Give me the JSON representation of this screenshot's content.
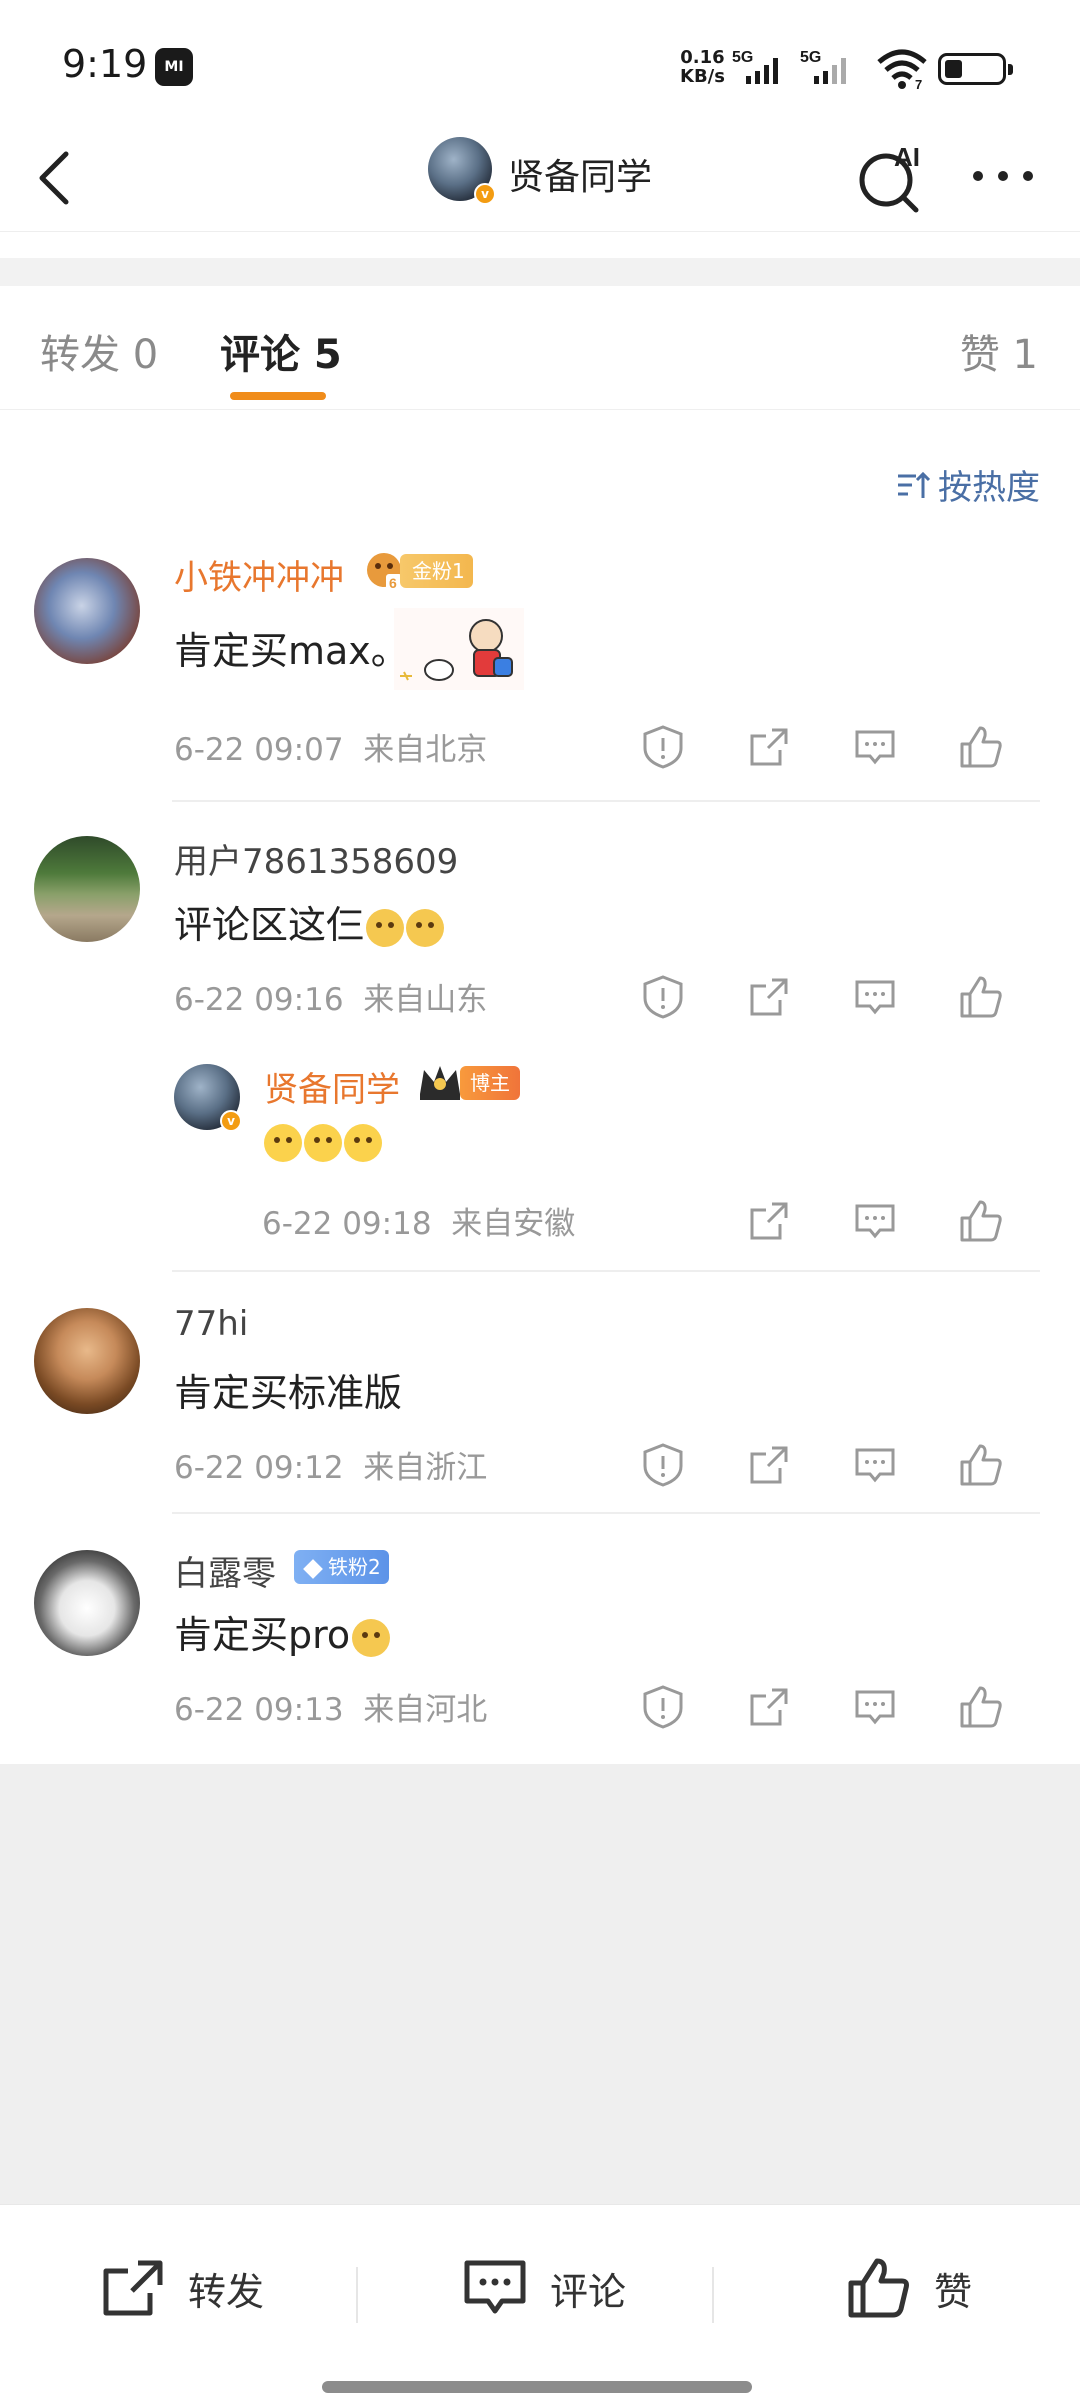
{
  "status_bar": {
    "time": "9:19",
    "mi_label": "MI",
    "net_speed_value": "0.16",
    "net_speed_unit": "KB/s",
    "sim1": "5G",
    "sim2": "5G",
    "wifi_sub": "7",
    "battery_level": 0.3
  },
  "nav": {
    "title": "贤备同学",
    "ai_label": "AI",
    "verified_mark": "v"
  },
  "tabs": {
    "repost": "转发 0",
    "comment": "评论 5",
    "like": "赞 1",
    "active": "comment"
  },
  "sort": {
    "label": "按热度"
  },
  "comments": [
    {
      "username": "小铁冲冲冲",
      "badge": "金粉1",
      "badge_level": "6",
      "text": "肯定买max。",
      "time": "6-22 09:07",
      "location": "来自北京"
    },
    {
      "username": "用户7861358609",
      "text": "评论区这仨",
      "time": "6-22 09:16",
      "location": "来自山东",
      "reply": {
        "username": "贤备同学",
        "badge": "博主",
        "time": "6-22 09:18",
        "location": "来自安徽"
      }
    },
    {
      "username": "77hi",
      "text": "肯定买标准版",
      "time": "6-22 09:12",
      "location": "来自浙江"
    },
    {
      "username": "白露零",
      "badge": "铁粉2",
      "text": "肯定买pro",
      "time": "6-22 09:13",
      "location": "来自河北"
    }
  ],
  "bottom_bar": {
    "repost": "转发",
    "comment": "评论",
    "like": "赞"
  },
  "colors": {
    "accent": "#f08c1a",
    "vip_name": "#e8772e",
    "sort_blue": "#4a6fa5"
  }
}
